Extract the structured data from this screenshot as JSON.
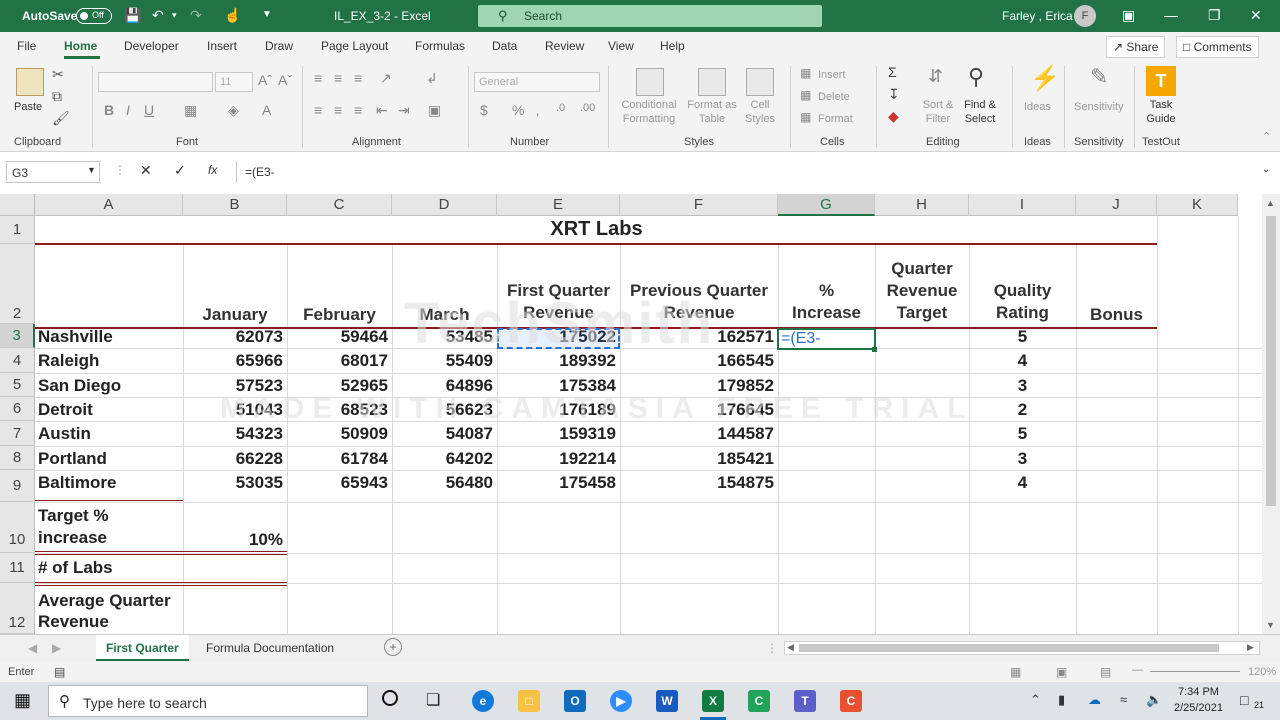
{
  "titlebar": {
    "autosave_label": "AutoSave",
    "autosave_state": "Off",
    "filename": "IL_EX_3-2 - Excel",
    "search_placeholder": "Search",
    "user_name": "Farley , Erica",
    "user_initial": "F"
  },
  "ribbon_tabs": [
    "File",
    "Home",
    "Developer",
    "Insert",
    "Draw",
    "Page Layout",
    "Formulas",
    "Data",
    "Review",
    "View",
    "Help"
  ],
  "ribbon_right": {
    "share": "Share",
    "comments": "Comments"
  },
  "ribbon": {
    "clipboard": {
      "paste": "Paste",
      "label": "Clipboard"
    },
    "font": {
      "name": "",
      "size": "11",
      "label": "Font"
    },
    "alignment": {
      "label": "Alignment"
    },
    "number": {
      "format": "General",
      "label": "Number"
    },
    "styles": {
      "conditional": "Conditional Formatting",
      "format_table": "Format as Table",
      "cell_styles": "Cell Styles",
      "label": "Styles"
    },
    "cells": {
      "insert": "Insert",
      "delete": "Delete",
      "format": "Format",
      "label": "Cells"
    },
    "editing": {
      "sort": "Sort & Filter",
      "find": "Find & Select",
      "label": "Editing"
    },
    "ideas": {
      "btn": "Ideas",
      "label": "Ideas"
    },
    "sensitivity": {
      "btn": "Sensitivity",
      "label": "Sensitivity"
    },
    "testout": {
      "btn": "Task Guide",
      "label": "TestOut"
    }
  },
  "formula_bar": {
    "name_box": "G3",
    "fx": "fx",
    "formula": "=(E3-"
  },
  "columns": [
    "A",
    "B",
    "C",
    "D",
    "E",
    "F",
    "G",
    "H",
    "I",
    "J",
    "K"
  ],
  "rows": [
    "1",
    "2",
    "3",
    "4",
    "5",
    "6",
    "7",
    "8",
    "9",
    "10",
    "11",
    "12"
  ],
  "sheet": {
    "title": "XRT Labs",
    "headers": {
      "b": "January",
      "c": "February",
      "d": "March",
      "e": [
        "First Quarter",
        "Revenue"
      ],
      "f": [
        "Previous Quarter",
        "Revenue"
      ],
      "g": [
        "%",
        "Increase"
      ],
      "h": [
        "Quarter",
        "Revenue",
        "Target"
      ],
      "i": [
        "Quality",
        "Rating"
      ],
      "j": "Bonus"
    },
    "data": [
      {
        "city": "Nashville",
        "jan": "62073",
        "feb": "59464",
        "mar": "53485",
        "fq": "175022",
        "pq": "162571",
        "pct": "=(E3-",
        "rating": "5"
      },
      {
        "city": "Raleigh",
        "jan": "65966",
        "feb": "68017",
        "mar": "55409",
        "fq": "189392",
        "pq": "166545",
        "pct": "",
        "rating": "4"
      },
      {
        "city": "San Diego",
        "jan": "57523",
        "feb": "52965",
        "mar": "64896",
        "fq": "175384",
        "pq": "179852",
        "pct": "",
        "rating": "3"
      },
      {
        "city": "Detroit",
        "jan": "51043",
        "feb": "68523",
        "mar": "56623",
        "fq": "176189",
        "pq": "176645",
        "pct": "",
        "rating": "2"
      },
      {
        "city": "Austin",
        "jan": "54323",
        "feb": "50909",
        "mar": "54087",
        "fq": "159319",
        "pq": "144587",
        "pct": "",
        "rating": "5"
      },
      {
        "city": "Portland",
        "jan": "66228",
        "feb": "61784",
        "mar": "64202",
        "fq": "192214",
        "pq": "185421",
        "pct": "",
        "rating": "3"
      },
      {
        "city": "Baltimore",
        "jan": "53035",
        "feb": "65943",
        "mar": "56480",
        "fq": "175458",
        "pq": "154875",
        "pct": "",
        "rating": "4"
      }
    ],
    "target_label": [
      "Target %",
      "increase"
    ],
    "target_value": "10%",
    "labs_label": "# of Labs",
    "avg_label": [
      "Average Quarter",
      "Revenue"
    ]
  },
  "sheet_tabs": [
    "First Quarter",
    "Formula Documentation"
  ],
  "status": {
    "mode": "Enter",
    "zoom": "120%"
  },
  "watermark": {
    "line1": "TechSmith",
    "line2": "MADE WITH CAMTASIA FREE TRIAL"
  },
  "taskbar": {
    "search_placeholder": "Type here to search",
    "time": "7:34 PM",
    "date": "2/25/2021",
    "notif_count": "21"
  }
}
